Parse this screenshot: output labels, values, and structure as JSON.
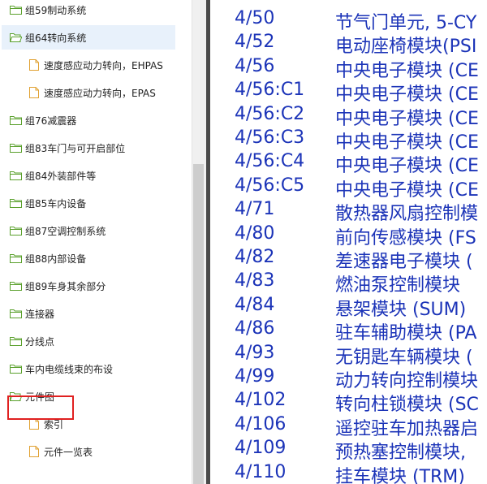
{
  "tree": {
    "items": [
      {
        "label": "组59制动系统",
        "kind": "folder",
        "open": false,
        "indent": 0
      },
      {
        "label": "组64转向系统",
        "kind": "folder",
        "open": true,
        "indent": 0,
        "selected": true
      },
      {
        "label": "速度感应动力转向，EHPAS",
        "kind": "doc",
        "indent": 1
      },
      {
        "label": "速度感应动力转向，EPAS",
        "kind": "doc",
        "indent": 1
      },
      {
        "label": "组76减震器",
        "kind": "folder",
        "open": false,
        "indent": 0
      },
      {
        "label": "组83车门与可开启部位",
        "kind": "folder",
        "open": false,
        "indent": 0
      },
      {
        "label": "组84外装部件等",
        "kind": "folder",
        "open": false,
        "indent": 0
      },
      {
        "label": "组85车内设备",
        "kind": "folder",
        "open": false,
        "indent": 0
      },
      {
        "label": "组87空调控制系统",
        "kind": "folder",
        "open": false,
        "indent": 0
      },
      {
        "label": "组88内部设备",
        "kind": "folder",
        "open": false,
        "indent": 0
      },
      {
        "label": "组89车身其余部分",
        "kind": "folder",
        "open": false,
        "indent": 0
      },
      {
        "label": "连接器",
        "kind": "folder",
        "open": false,
        "indent": 0
      },
      {
        "label": "分线点",
        "kind": "folder",
        "open": false,
        "indent": 0
      },
      {
        "label": "车内电缆线束的布设",
        "kind": "folder",
        "open": false,
        "indent": 0
      },
      {
        "label": "元件图",
        "kind": "folder",
        "open": true,
        "indent": 0,
        "highlighted": true
      },
      {
        "label": "索引",
        "kind": "doc",
        "indent": 1
      },
      {
        "label": "元件一览表",
        "kind": "doc",
        "indent": 1
      }
    ]
  },
  "content": {
    "rows": [
      {
        "code": "4/50",
        "desc": "节气门单元, 5-CY"
      },
      {
        "code": "4/52",
        "desc": "电动座椅模块(PSI"
      },
      {
        "code": "4/56",
        "desc": "中央电子模块 (CE"
      },
      {
        "code": "4/56:C1",
        "desc": "中央电子模块 (CE"
      },
      {
        "code": "4/56:C2",
        "desc": "中央电子模块 (CE"
      },
      {
        "code": "4/56:C3",
        "desc": "中央电子模块 (CE"
      },
      {
        "code": "4/56:C4",
        "desc": "中央电子模块 (CE"
      },
      {
        "code": "4/56:C5",
        "desc": "中央电子模块 (CE"
      },
      {
        "code": "4/71",
        "desc": "散热器风扇控制模"
      },
      {
        "code": "4/80",
        "desc": "前向传感模块 (FS"
      },
      {
        "code": "4/82",
        "desc": "差速器电子模块 ("
      },
      {
        "code": "4/83",
        "desc": "燃油泵控制模块"
      },
      {
        "code": "4/84",
        "desc": "悬架模块 (SUM)"
      },
      {
        "code": "4/86",
        "desc": "驻车辅助模块 (PA"
      },
      {
        "code": "4/93",
        "desc": "无钥匙车辆模块 ("
      },
      {
        "code": "4/99",
        "desc": "动力转向控制模块"
      },
      {
        "code": "4/102",
        "desc": "转向柱锁模块 (SC"
      },
      {
        "code": "4/106",
        "desc": "遥控驻车加热器启"
      },
      {
        "code": "4/109",
        "desc": "预热塞控制模块, "
      },
      {
        "code": "4/110",
        "desc": "挂车模块 (TRM)"
      }
    ]
  },
  "colors": {
    "link_text": "#1c34b8",
    "folder": "#5aa02c",
    "doc": "#e0a030",
    "selected_bg": "#e8f1fb",
    "highlight": "#e02020"
  }
}
